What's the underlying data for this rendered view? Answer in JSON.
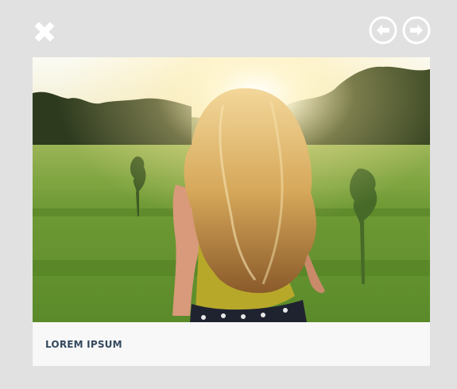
{
  "lightbox": {
    "close_icon": "close-x-icon",
    "prev_icon": "arrow-left-circle-icon",
    "next_icon": "arrow-right-circle-icon",
    "caption": "LOREM IPSUM"
  },
  "colors": {
    "background": "#e1e1e1",
    "control_icon": "#ffffff",
    "caption_text": "#34495e",
    "caption_bar": "#f8f8f8"
  }
}
